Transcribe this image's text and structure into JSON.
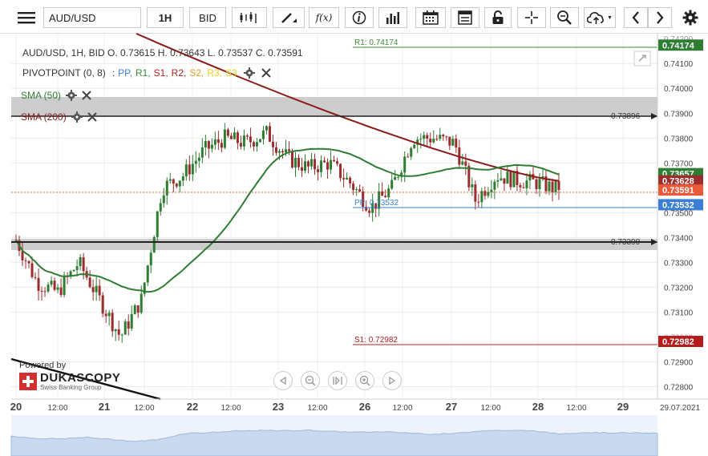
{
  "toolbar": {
    "symbol": "AUD/USD",
    "interval": "1H",
    "price_type": "BID",
    "fx_label": "f(x)"
  },
  "legend": {
    "ohlc": "AUD/USD, 1H, BID    O. 0.73615 H. 0.73643 L. 0.73537 C. 0.73591",
    "pivot_name": "PIVOTPOINT (0, 8)",
    "pivot_levels": [
      {
        "label": "PP,",
        "color": "#3a7fd5"
      },
      {
        "label": "R1,",
        "color": "#3b8a3b"
      },
      {
        "label": "S1,",
        "color": "#b02020"
      },
      {
        "label": "R2,",
        "color": "#b02020"
      },
      {
        "label": "S2,",
        "color": "#e0a020"
      },
      {
        "label": "R3,",
        "color": "#e8d020"
      },
      {
        "label": "S3",
        "color": "#e8d020"
      }
    ],
    "sma50": "SMA (50)",
    "sma200": "SMA (200)"
  },
  "price_axis": {
    "ticks": [
      "0.74100",
      "0.74000",
      "0.73900",
      "0.73800",
      "0.73700",
      "0.73500",
      "0.73400",
      "0.73300",
      "0.73200",
      "0.73100",
      "0.72900",
      "0.72800"
    ],
    "badges": [
      {
        "label": "0.74174",
        "color": "#2e7d32"
      },
      {
        "label": "0.73657",
        "color": "#2e7d32"
      },
      {
        "label": "0.73628",
        "color": "#9b2d2d"
      },
      {
        "label": "0.73591",
        "color": "#ea5a3a"
      },
      {
        "label": "0.73532",
        "color": "#3a7fd5"
      },
      {
        "label": "0.72982",
        "color": "#b71c1c"
      }
    ],
    "partial_labels": [
      "0.74200",
      "0.73000"
    ]
  },
  "time_axis": {
    "labels": [
      "20",
      "12:00",
      "21",
      "12:00",
      "22",
      "12:00",
      "23",
      "12:00",
      "26",
      "12:00",
      "27",
      "12:00",
      "28",
      "12:00",
      "29",
      "29.07.2021"
    ]
  },
  "annotations": {
    "r1": "R1: 0.74174",
    "pp": "PP: 0.73532",
    "s1": "S1: 0.72982",
    "hline_upper": "0.73896",
    "hline_lower": "0.73390"
  },
  "watermark": {
    "powered": "Powered by",
    "brand": "DUKASCOPY",
    "tagline": "Swiss Banking Group"
  },
  "colors": {
    "sma50": "#2e7d32",
    "sma200": "#8b1a1a",
    "bull": "#2e7d32",
    "bear": "#9b2d2d"
  },
  "chart_data": {
    "type": "candlestick",
    "symbol": "AUD/USD",
    "timeframe": "1H",
    "x_range": [
      "2021-07-20",
      "2021-07-29"
    ],
    "y_range": [
      0.7275,
      0.7422
    ],
    "last_bar": {
      "open": 0.73615,
      "high": 0.73643,
      "low": 0.73537,
      "close": 0.73591
    },
    "levels": {
      "R1": 0.74174,
      "PP": 0.73532,
      "S1": 0.72982
    },
    "horizontal_lines": [
      0.73896,
      0.7339
    ],
    "sma50_last": 0.73657,
    "sma200_last": 0.73628,
    "close_path": [
      [
        "2021-07-20 00:00",
        0.7339
      ],
      [
        "2021-07-20 06:00",
        0.7322
      ],
      [
        "2021-07-20 12:00",
        0.7318
      ],
      [
        "2021-07-20 18:00",
        0.733
      ],
      [
        "2021-07-21 00:00",
        0.7315
      ],
      [
        "2021-07-21 06:00",
        0.73
      ],
      [
        "2021-07-21 12:00",
        0.7315
      ],
      [
        "2021-07-21 18:00",
        0.736
      ],
      [
        "2021-07-22 00:00",
        0.7365
      ],
      [
        "2021-07-22 06:00",
        0.7375
      ],
      [
        "2021-07-22 12:00",
        0.738
      ],
      [
        "2021-07-22 18:00",
        0.7378
      ],
      [
        "2021-07-23 00:00",
        0.7382
      ],
      [
        "2021-07-23 06:00",
        0.7372
      ],
      [
        "2021-07-23 12:00",
        0.7368
      ],
      [
        "2021-07-23 18:00",
        0.737
      ],
      [
        "2021-07-26 00:00",
        0.7362
      ],
      [
        "2021-07-26 06:00",
        0.7352
      ],
      [
        "2021-07-26 12:00",
        0.736
      ],
      [
        "2021-07-26 18:00",
        0.738
      ],
      [
        "2021-07-27 00:00",
        0.738
      ],
      [
        "2021-07-27 06:00",
        0.7378
      ],
      [
        "2021-07-27 12:00",
        0.7355
      ],
      [
        "2021-07-27 18:00",
        0.7365
      ],
      [
        "2021-07-28 00:00",
        0.7363
      ],
      [
        "2021-07-28 06:00",
        0.7362
      ],
      [
        "2021-07-28 10:00",
        0.73591
      ]
    ]
  }
}
